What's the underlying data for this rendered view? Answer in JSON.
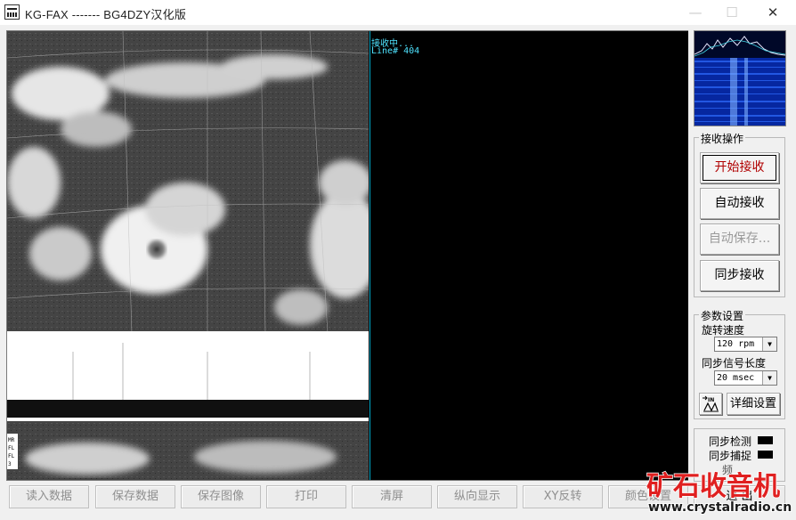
{
  "window": {
    "title": "KG-FAX ------- BG4DZY汉化版",
    "minimize": "—",
    "maximize": "☐",
    "close": "✕"
  },
  "status": {
    "line1": "接收中...",
    "line2": "Line# 404"
  },
  "receive_group": {
    "title": "接收操作",
    "start": "开始接收",
    "auto": "自动接收",
    "auto_save": "自动保存...",
    "sync": "同步接收"
  },
  "params_group": {
    "title": "参数设置",
    "speed_label": "旋转速度",
    "speed_value": "120 rpm",
    "sync_len_label": "同步信号长度",
    "sync_len_value": "20 msec",
    "detail_button": "详细设置",
    "icon_text": "IN"
  },
  "indicators": {
    "sync_detect": "同步检测",
    "sync_capture": "同步捕捉",
    "third_partial": "频"
  },
  "image_margin": {
    "t1": "MR",
    "t2": "FL",
    "t3": "FL",
    "t4": "3"
  },
  "bottom_buttons": [
    "读入数据",
    "保存数据",
    "保存图像",
    "打印",
    "清屏",
    "纵向显示",
    "XY反转",
    "颜色设置",
    "退 出"
  ],
  "watermark": {
    "text": "矿石收音机",
    "url": "www.crystalradio.cn"
  },
  "colors": {
    "status_text": "#4fe3ff",
    "primary_button_text": "#b00000",
    "watermark_red": "#e02020"
  }
}
